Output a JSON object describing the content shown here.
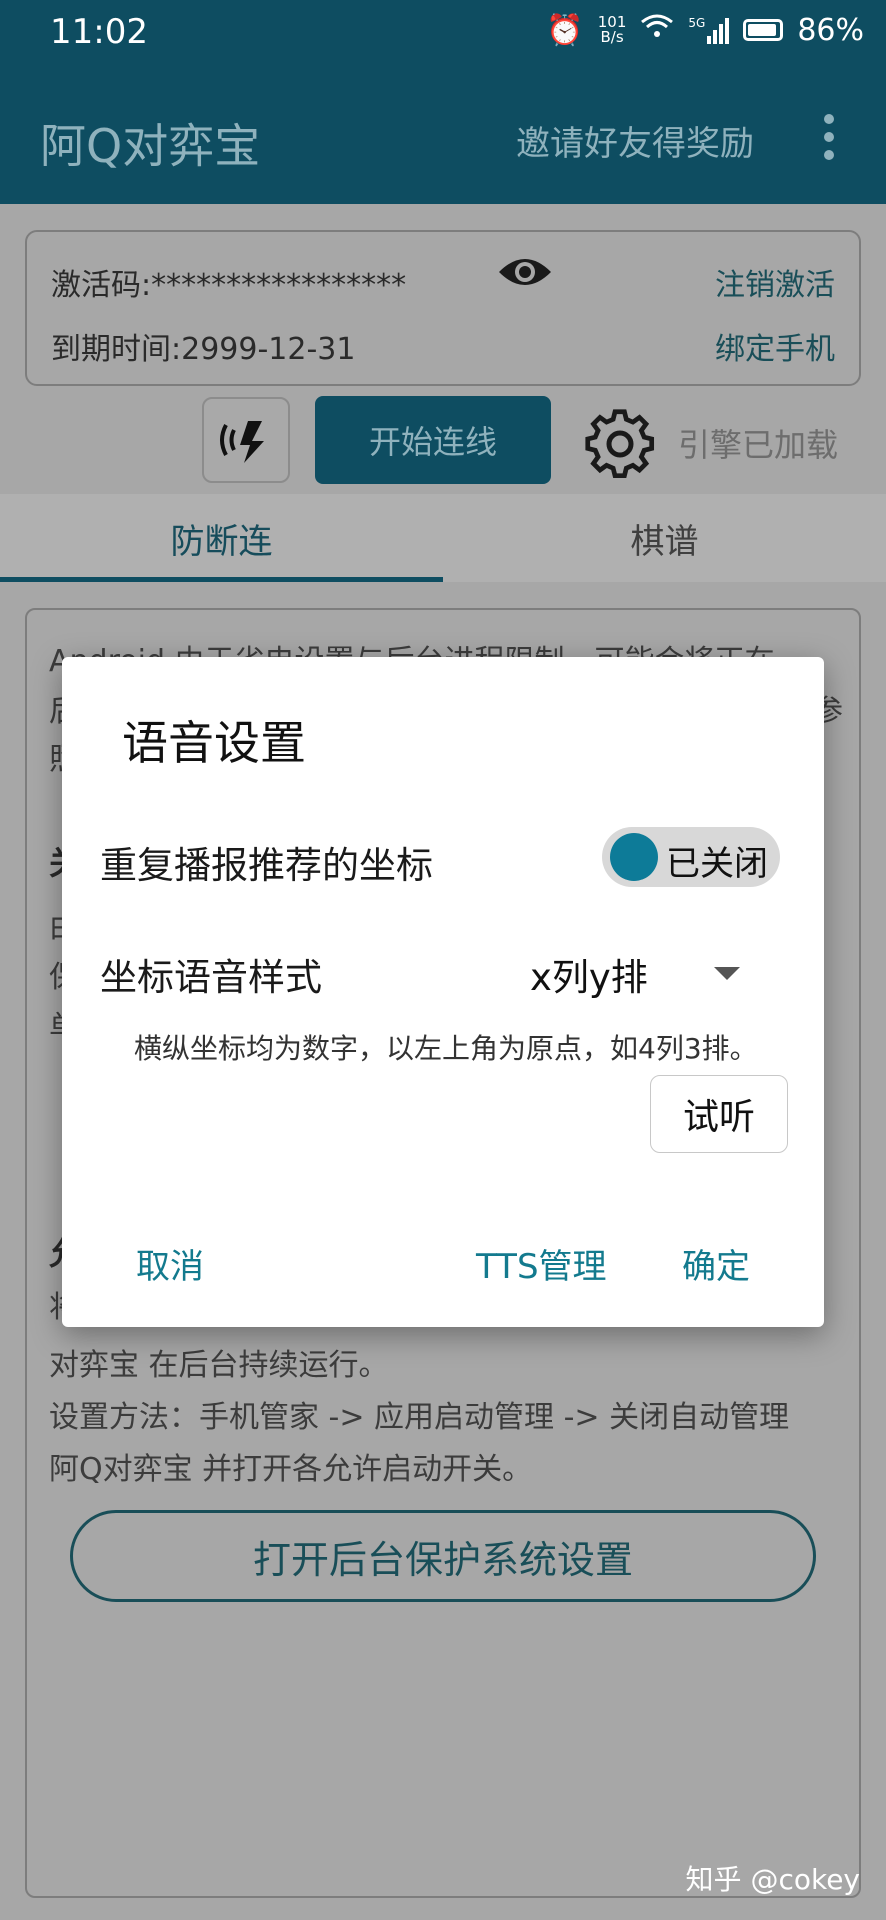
{
  "status_bar": {
    "time": "11:02",
    "net_speed_top": "101",
    "net_speed_unit": "B/s",
    "network": "5G",
    "battery": "86%"
  },
  "app_bar": {
    "title": "阿Q对弈宝",
    "invite": "邀请好友得奖励"
  },
  "activation": {
    "code_label": "激活码:*****************",
    "logout": "注销激活",
    "expiry": "到期时间:2999-12-31",
    "bind_phone": "绑定手机"
  },
  "toolbar": {
    "connect": "开始连线",
    "engine_status": "引擎已加载"
  },
  "tabs": [
    {
      "label": "防断连"
    },
    {
      "label": "棋谱"
    }
  ],
  "background": {
    "line1": "Android 由于省电设置与后台进程限制，可能会将正在",
    "line2": "后",
    "line2_end": "参",
    "line3": "照",
    "sec1": "关",
    "s1a": "由",
    "s1b": "保",
    "s1c": "单",
    "sec2": "允",
    "s2a": "将",
    "l4": "对弈宝 在后台持续运行。",
    "l5": "设置方法：手机管家 -> 应用启动管理 -> 关闭自动管理",
    "l6": "阿Q对弈宝 并打开各允许启动开关。",
    "protect_button": "打开后台保护系统设置"
  },
  "dialog": {
    "title": "语音设置",
    "repeat_label": "重复播报推荐的坐标",
    "repeat_toggle": "已关闭",
    "style_label": "坐标语音样式",
    "style_value": "x列y排",
    "hint": "横纵坐标均为数字，以左上角为原点，如4列3排。",
    "listen": "试听",
    "cancel": "取消",
    "tts": "TTS管理",
    "ok": "确定"
  },
  "watermark": "知乎 @cokey"
}
